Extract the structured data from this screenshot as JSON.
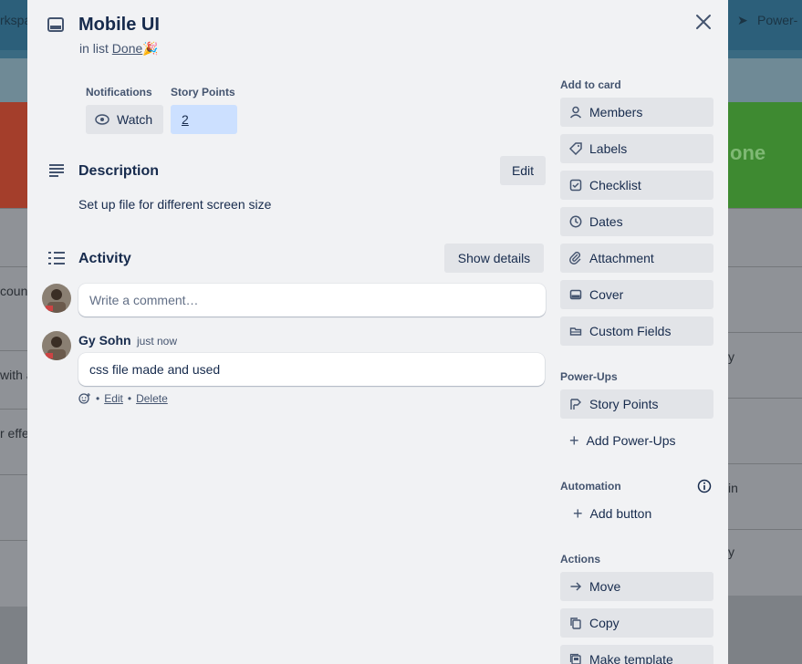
{
  "board": {
    "top_left_text": "rkspa",
    "top_right_text": "Power-",
    "right_col_text": "one",
    "left_snippets": [
      "coun",
      "with a",
      "r effe"
    ],
    "right_snippets": [
      "y",
      "in",
      "y"
    ]
  },
  "card": {
    "title": "Mobile UI",
    "in_list_prefix": "in list",
    "list_name": "Done",
    "list_emoji": "🎉"
  },
  "notifications": {
    "label": "Notifications",
    "watch_label": "Watch"
  },
  "story_points": {
    "label": "Story Points",
    "value": "2"
  },
  "description": {
    "title": "Description",
    "edit_label": "Edit",
    "text": "Set up file for different screen size"
  },
  "activity": {
    "title": "Activity",
    "show_details_label": "Show details",
    "comment_placeholder": "Write a comment…",
    "comments": [
      {
        "author": "Gy Sohn",
        "time": "just now",
        "text": "css file made and used",
        "edit_label": "Edit",
        "delete_label": "Delete"
      }
    ]
  },
  "sidebar": {
    "add_to_card_label": "Add to card",
    "add_to_card": [
      {
        "label": "Members",
        "icon": "person-icon"
      },
      {
        "label": "Labels",
        "icon": "tag-icon"
      },
      {
        "label": "Checklist",
        "icon": "checkbox-icon"
      },
      {
        "label": "Dates",
        "icon": "clock-icon"
      },
      {
        "label": "Attachment",
        "icon": "paperclip-icon"
      },
      {
        "label": "Cover",
        "icon": "cover-icon"
      },
      {
        "label": "Custom Fields",
        "icon": "custom-fields-icon"
      }
    ],
    "power_ups_label": "Power-Ups",
    "story_points_label": "Story Points",
    "add_power_ups_label": "Add Power-Ups",
    "automation_label": "Automation",
    "add_button_label": "Add button",
    "actions_label": "Actions",
    "actions": [
      {
        "label": "Move",
        "icon": "arrow-right-icon"
      },
      {
        "label": "Copy",
        "icon": "copy-icon"
      },
      {
        "label": "Make template",
        "icon": "template-icon"
      }
    ]
  },
  "colors": {
    "modal_bg": "#f1f2f4",
    "button_bg": "#e2e4e8",
    "story_points_bg": "#cce0ff",
    "text": "#172b4d",
    "subtle_text": "#44546f"
  }
}
